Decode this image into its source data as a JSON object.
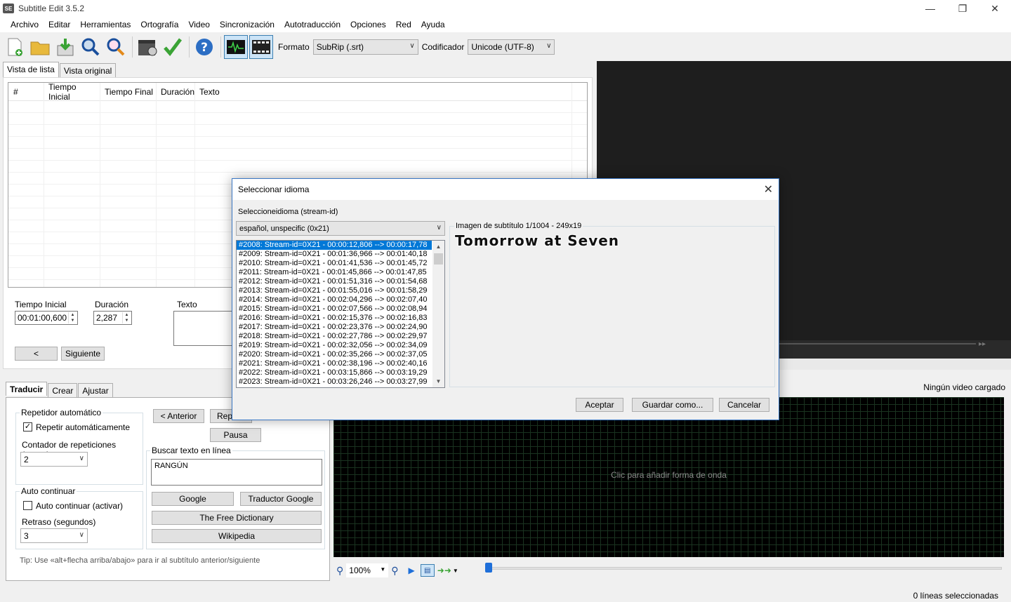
{
  "window": {
    "title": "Subtitle Edit 3.5.2",
    "app_icon_text": "SE"
  },
  "menu": [
    "Archivo",
    "Editar",
    "Herramientas",
    "Ortografía",
    "Video",
    "Sincronización",
    "Autotraducción",
    "Opciones",
    "Red",
    "Ayuda"
  ],
  "toolbar": {
    "format_label": "Formato",
    "format_value": "SubRip (.srt)",
    "encoding_label": "Codificador",
    "encoding_value": "Unicode (UTF-8)"
  },
  "tabs_top": [
    "Vista de lista",
    "Vista original"
  ],
  "grid": {
    "columns": [
      "#",
      "Tiempo Inicial",
      "Tiempo Final",
      "Duración",
      "Texto"
    ]
  },
  "edit": {
    "start_label": "Tiempo Inicial",
    "start_value": "00:01:00,600",
    "duration_label": "Duración",
    "duration_value": "2,287",
    "text_label": "Texto",
    "prev_button": "<",
    "next_button": "Siguiente"
  },
  "tabs_bottom": [
    "Traducir",
    "Crear",
    "Ajustar"
  ],
  "translate": {
    "auto_repeat_group": "Repetidor automático",
    "auto_repeat_check": "Repetir automáticamente",
    "repeat_count_label": "Contador de repeticiones (veces)",
    "repeat_count_value": "2",
    "auto_continue_group": "Auto continuar",
    "auto_continue_check": "Auto continuar (activar)",
    "delay_label": "Retraso (segundos)",
    "delay_value": "3",
    "prev_button": "< Anterior",
    "repeat_button": "Repe",
    "pause_button": "Pausa",
    "search_group": "Buscar texto en línea",
    "search_text": "RANGÚN",
    "google_button": "Google",
    "google_translate_button": "Traductor Google",
    "free_dictionary_button": "The Free Dictionary",
    "wikipedia_button": "Wikipedia",
    "tip": "Tip: Use «alt+flecha arriba/abajo» para ir al subtítulo anterior/siguiente"
  },
  "waveform": {
    "no_video": "Ningún video cargado",
    "click_text": "Clic para añadir forma de onda",
    "zoom": "100%"
  },
  "status": {
    "selected_lines": "0 líneas seleccionadas"
  },
  "dialog": {
    "title": "Seleccionar idioma",
    "select_label": "Seleccioneidioma (stream-id)",
    "language_value": "español, unspecific (0x21)",
    "image_group": "Imagen de subtítulo 1/1004 - 249x19",
    "subtitle_image_text": "Tomorrow at Seven",
    "items": [
      "#2008: Stream-id=0X21 - 00:00:12,806 --> 00:00:17,78",
      "#2009: Stream-id=0X21 - 00:01:36,966 --> 00:01:40,18",
      "#2010: Stream-id=0X21 - 00:01:41,536 --> 00:01:45,72",
      "#2011: Stream-id=0X21 - 00:01:45,866 --> 00:01:47,85",
      "#2012: Stream-id=0X21 - 00:01:51,316 --> 00:01:54,68",
      "#2013: Stream-id=0X21 - 00:01:55,016 --> 00:01:58,29",
      "#2014: Stream-id=0X21 - 00:02:04,296 --> 00:02:07,40",
      "#2015: Stream-id=0X21 - 00:02:07,566 --> 00:02:08,94",
      "#2016: Stream-id=0X21 - 00:02:15,376 --> 00:02:16,83",
      "#2017: Stream-id=0X21 - 00:02:23,376 --> 00:02:24,90",
      "#2018: Stream-id=0X21 - 00:02:27,786 --> 00:02:29,97",
      "#2019: Stream-id=0X21 - 00:02:32,056 --> 00:02:34,09",
      "#2020: Stream-id=0X21 - 00:02:35,266 --> 00:02:37,05",
      "#2021: Stream-id=0X21 - 00:02:38,196 --> 00:02:40,16",
      "#2022: Stream-id=0X21 - 00:03:15,866 --> 00:03:19,29",
      "#2023: Stream-id=0X21 - 00:03:26,246 --> 00:03:27,99"
    ],
    "accept_button": "Aceptar",
    "save_as_button": "Guardar como...",
    "cancel_button": "Cancelar"
  },
  "colors": {
    "selection": "#0078d7",
    "dialog_border": "#3a77c4",
    "video_bg": "#1e1e1e"
  }
}
